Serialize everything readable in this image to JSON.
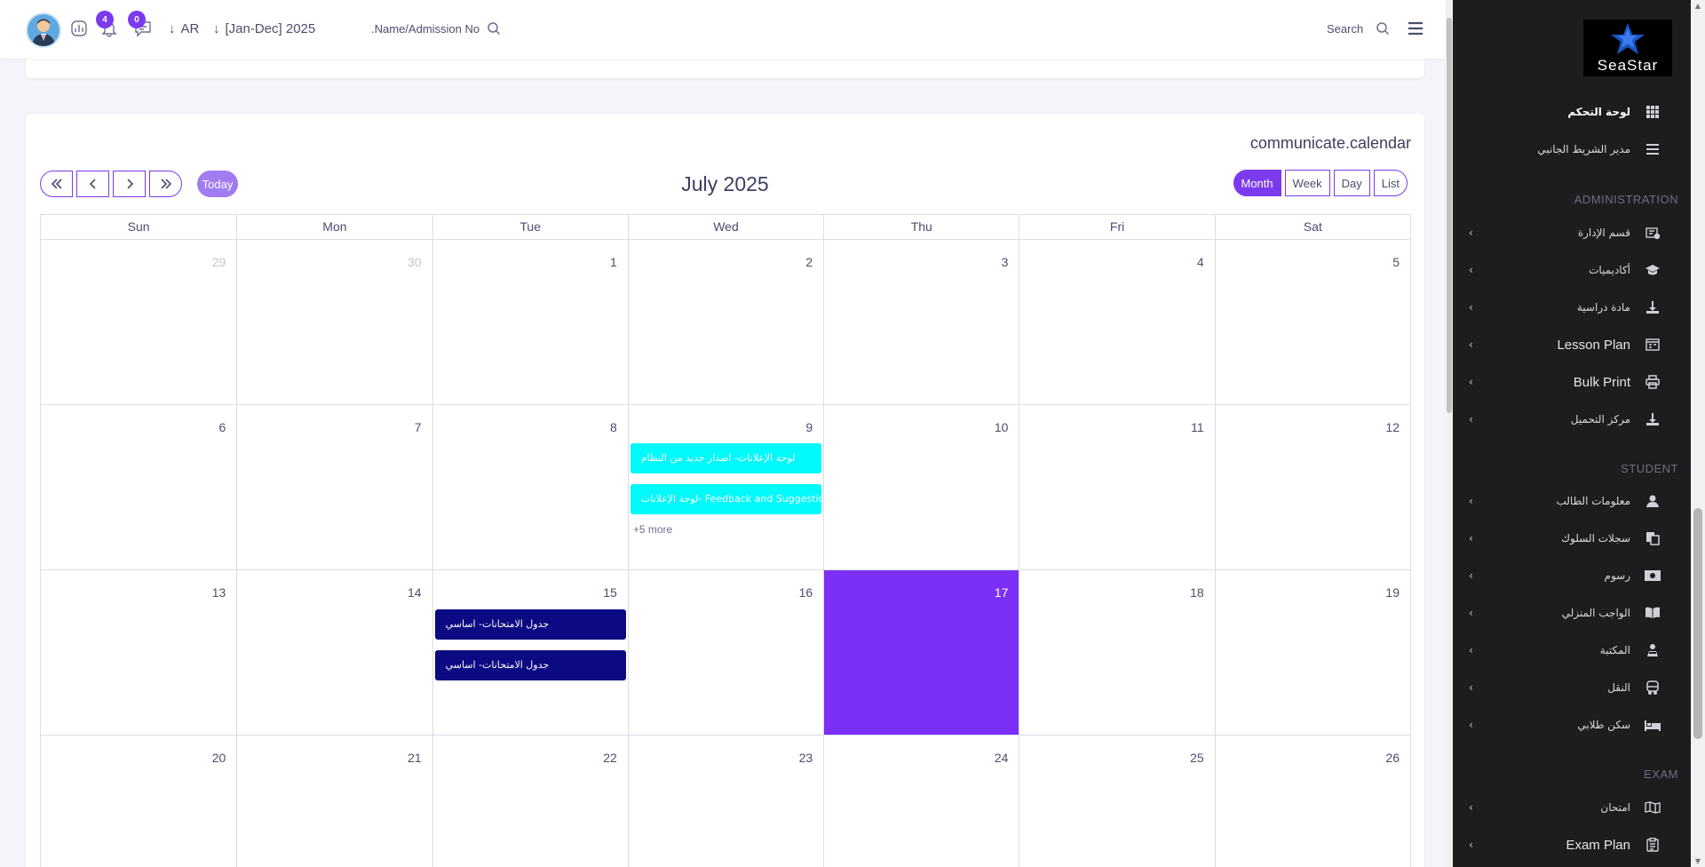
{
  "header": {
    "notification_count": "4",
    "message_count": "0",
    "language": "AR",
    "session": "[Jan-Dec] 2025",
    "student_search_placeholder": "Name/Admission No.",
    "search_label": "Search"
  },
  "calendar": {
    "title": "communicate.calendar",
    "month_label": "July 2025",
    "today_label": "Today",
    "views": [
      "Month",
      "Week",
      "Day",
      "List"
    ],
    "days_of_week": [
      "Sun",
      "Mon",
      "Tue",
      "Wed",
      "Thu",
      "Fri",
      "Sat"
    ],
    "weeks": [
      [
        "29",
        "30",
        "1",
        "2",
        "3",
        "4",
        "5"
      ],
      [
        "6",
        "7",
        "8",
        "9",
        "10",
        "11",
        "12"
      ],
      [
        "13",
        "14",
        "15",
        "16",
        "17",
        "18",
        "19"
      ],
      [
        "20",
        "21",
        "22",
        "23",
        "24",
        "25",
        "26"
      ]
    ],
    "events": {
      "jul9_a": "لوحة الإعلانات- اصدار جديد من النظام",
      "jul9_b": "لوحة الإعلانات- Feedback and Suggestions",
      "jul9_more": "+5 more",
      "jul15_a": "جدول الامتحانات- اساسي",
      "jul15_b": "جدول الامتحانات- اساسي"
    },
    "colors": {
      "today": "#7b2ff7",
      "event_cyan": "#00fafa",
      "event_navy": "#0b0a82",
      "accent": "#7c3aed"
    }
  },
  "sidebar": {
    "brand": "SeaStar",
    "items": {
      "dashboard": "لوحة التحكم",
      "sidebar_manager": "مدير الشريط الجانبي",
      "section_admin": "ADMINISTRATION",
      "admin_dept": "قسم الإدارة",
      "academics": "أكاديميات",
      "study_material": "مادة دراسية",
      "lesson_plan": "Lesson Plan",
      "bulk_print": "Bulk Print",
      "download_center": "مركز التحميل",
      "section_student": "STUDENT",
      "student_info": "معلومات الطالب",
      "behaviour": "سجلات السلوك",
      "fees": "رسوم",
      "homework": "الواجب المنزلي",
      "library": "المكتبة",
      "transport": "النقل",
      "dormitory": "سكن طلابي",
      "section_exam": "EXAM",
      "exam": "امتحان",
      "exam_plan": "Exam Plan"
    }
  }
}
